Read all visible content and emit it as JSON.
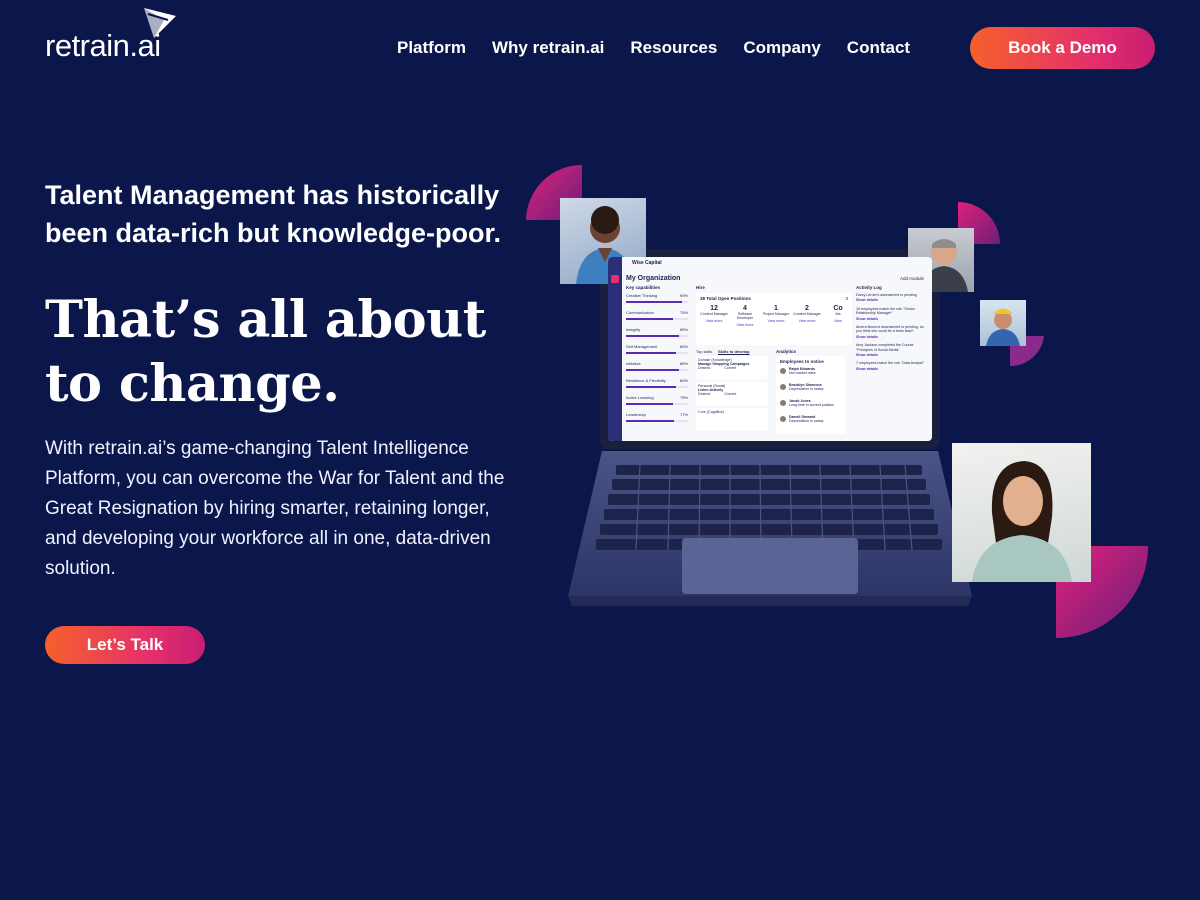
{
  "brand": {
    "logo_text": "retrain",
    "logo_suffix": ".ai",
    "colors": {
      "background": "#0b164b",
      "accent_start": "#f5612b",
      "accent_end": "#c81e73"
    }
  },
  "nav": {
    "items": [
      "Platform",
      "Why retrain.ai",
      "Resources",
      "Company",
      "Contact"
    ],
    "cta": "Book a Demo"
  },
  "hero": {
    "tagline": "Talent Management has historically been data-rich but knowledge-poor.",
    "headline": "That’s all about to change.",
    "description": "With retrain.ai’s game-changing Talent Intelligence Platform, you can overcome the War for Talent and the Great Resignation by hiring smarter, retaining longer, and developing your workforce all in one, data-driven solution.",
    "cta": "Let’s Talk"
  },
  "dashboard": {
    "company": "Wise Capital",
    "title": "My Organization",
    "add_module": "Add module",
    "key_capabilities_label": "Key capabilities",
    "capabilities": [
      {
        "name": "Creative Thinking",
        "pct": "90%",
        "level": 0.9
      },
      {
        "name": "Communication",
        "pct": "75%",
        "level": 0.75
      },
      {
        "name": "Integrity",
        "pct": "85%",
        "level": 0.85
      },
      {
        "name": "Self Management",
        "pct": "80%",
        "level": 0.8
      },
      {
        "name": "Initiative",
        "pct": "85%",
        "level": 0.85
      },
      {
        "name": "Resilience & Flexibility",
        "pct": "80%",
        "level": 0.8
      },
      {
        "name": "Active Learning",
        "pct": "75%",
        "level": 0.75
      },
      {
        "name": "Leadership",
        "pct": "77%",
        "level": 0.77
      }
    ],
    "hire_label": "Hire",
    "open_positions_label": "38 Total Open Positions",
    "open_positions_count": "3",
    "positions": [
      {
        "count": "12",
        "role": "Content Manager",
        "link": "View more"
      },
      {
        "count": "4",
        "role": "Software Developer",
        "link": "View more"
      },
      {
        "count": "1",
        "role": "Project Manager",
        "link": "View more"
      },
      {
        "count": "2",
        "role": "Content Manager",
        "link": "View more"
      },
      {
        "count": "Co",
        "role": "Ma",
        "link": "View"
      }
    ],
    "tabs": [
      "Top skills",
      "Skills to develop"
    ],
    "skills": [
      {
        "domain": "Domain (Knowledge)",
        "name": "Manage Shopping Campaigns",
        "desired": "Desired",
        "current": "Current"
      },
      {
        "domain": "Personal (Social)",
        "name": "Listen Actively",
        "desired": "Desired",
        "current": "Current"
      },
      {
        "domain": "Core (Cognitive)",
        "name": "",
        "desired": "",
        "current": ""
      }
    ],
    "analytics_label": "Analytics",
    "employees_label": "Employees to notice",
    "employees": [
      {
        "name": "Ralph Edwards",
        "note": "Not market rates"
      },
      {
        "name": "Brooklyn Simmons",
        "note": "Depreciation in salary"
      },
      {
        "name": "Jacob Jones",
        "note": "Long time in current position"
      },
      {
        "name": "Darrell Steward",
        "note": "Depreciation in salary"
      }
    ],
    "activity_label": "Activity Log",
    "activities": [
      {
        "text": "Darcy Lerner's assessment is pending",
        "link": "Show details"
      },
      {
        "text": "16 employees match the role \"Senior Relationship Manager\"",
        "link": "Show details"
      },
      {
        "text": "Amera Brown's assessment is pending, do you think she could be a team lead?",
        "link": "Show details"
      },
      {
        "text": "Amy Jackson completed the Course \"Principles of Social Media\"",
        "link": "Show details"
      },
      {
        "text": "7 employees match the role \"Data Analyst\"",
        "link": "Show details"
      }
    ]
  }
}
